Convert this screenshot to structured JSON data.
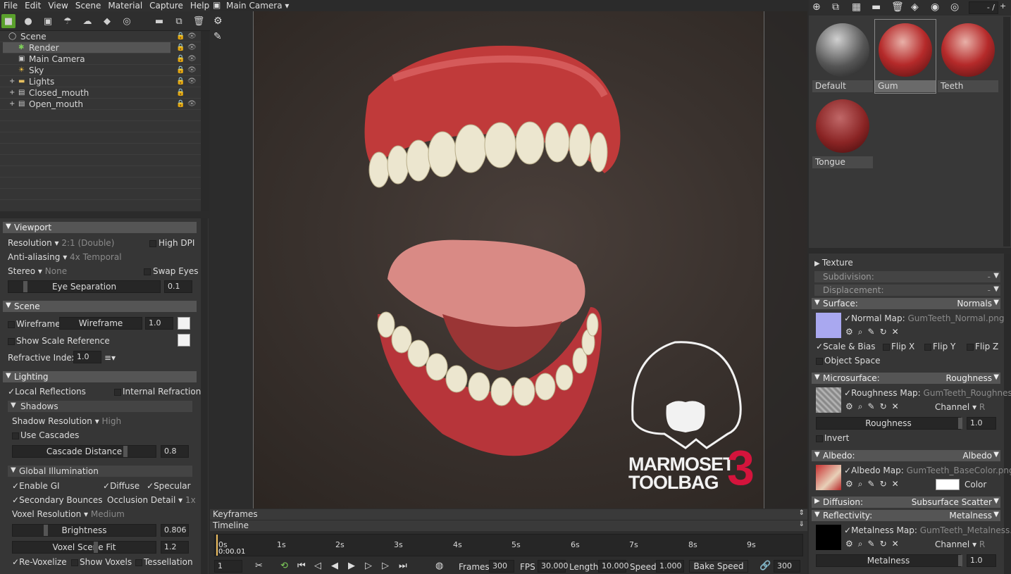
{
  "menu": [
    "File",
    "Edit",
    "View",
    "Scene",
    "Material",
    "Capture",
    "Help"
  ],
  "viewport_header": {
    "camera": "Main Camera"
  },
  "scene_tree": [
    {
      "label": "Scene",
      "icon": "scene-icon",
      "indent": 0,
      "visible": true
    },
    {
      "label": "Render",
      "icon": "render-icon",
      "indent": 1,
      "selected": true,
      "visible": true
    },
    {
      "label": "Main Camera",
      "icon": "camera-icon",
      "indent": 1,
      "visible": true
    },
    {
      "label": "Sky",
      "icon": "sky-icon",
      "indent": 1,
      "visible": true
    },
    {
      "label": "Lights",
      "icon": "folder-icon",
      "indent": 1,
      "visible": true
    },
    {
      "label": "Closed_mouth",
      "icon": "mesh-icon",
      "indent": 1,
      "visible": false
    },
    {
      "label": "Open_mouth",
      "icon": "mesh-icon",
      "indent": 1,
      "visible": true
    }
  ],
  "viewport_section": {
    "title": "Viewport",
    "resolution_label": "Resolution",
    "resolution_value": "2:1 (Double)",
    "high_dpi": "High DPI",
    "aa_label": "Anti-aliasing",
    "aa_value": "4x Temporal",
    "stereo_label": "Stereo",
    "stereo_value": "None",
    "swap_eyes": "Swap Eyes",
    "eye_sep_label": "Eye Separation",
    "eye_sep_value": "0.1"
  },
  "scene_section": {
    "title": "Scene",
    "wireframe": "Wireframe",
    "wireframe_slider": "Wireframe",
    "wireframe_value": "1.0",
    "show_scale": "Show Scale Reference",
    "refr_label": "Refractive Index:",
    "refr_value": "1.0"
  },
  "lighting_section": {
    "title": "Lighting",
    "local_refl": "Local Reflections",
    "internal_refr": "Internal Refraction",
    "shadows": "Shadows",
    "shadow_res_label": "Shadow Resolution",
    "shadow_res_value": "High",
    "use_cascades": "Use Cascades",
    "cascade_label": "Cascade Distance",
    "cascade_value": "0.8",
    "gi": "Global Illumination",
    "enable_gi": "Enable GI",
    "diffuse": "Diffuse",
    "specular": "Specular",
    "sec_bounces": "Secondary Bounces",
    "occl_label": "Occlusion Detail",
    "occl_value": "1x",
    "voxel_res_label": "Voxel Resolution",
    "voxel_res_value": "Medium",
    "brightness_label": "Brightness",
    "brightness_value": "0.806",
    "voxel_fit_label": "Voxel Scene Fit",
    "voxel_fit_value": "1.2",
    "revoxelize": "Re-Voxelize",
    "show_voxels": "Show Voxels",
    "tessellation": "Tessellation"
  },
  "logo": {
    "line1": "MARMOSET",
    "line2": "TOOLBAG",
    "version": "3"
  },
  "timeline": {
    "keyframes": "Keyframes",
    "timeline": "Timeline",
    "time": "0:00.01",
    "ticks": [
      "0s",
      "1s",
      "2s",
      "3s",
      "4s",
      "5s",
      "6s",
      "7s",
      "8s",
      "9s"
    ],
    "frame": "1",
    "frames_label": "Frames",
    "frames": "300",
    "fps_label": "FPS",
    "fps": "30.000",
    "length_label": "Length",
    "length": "10.000",
    "speed_label": "Speed",
    "speed": "1.000",
    "bake_speed": "Bake Speed",
    "bake_value": "300"
  },
  "materials": {
    "page": "- /",
    "items": [
      {
        "name": "Default",
        "selected": false
      },
      {
        "name": "Gum",
        "selected": true
      },
      {
        "name": "Teeth",
        "selected": false
      },
      {
        "name": "Tongue",
        "selected": false
      }
    ]
  },
  "material_editor": {
    "texture": "Texture",
    "subdivision": "Subdivision:",
    "sub_value": "-",
    "displacement": "Displacement:",
    "disp_value": "-",
    "surface": "Surface:",
    "surface_value": "Normals",
    "normal_map_label": "Normal Map:",
    "normal_map_file": "GumTeeth_Normal.png",
    "scale_bias": "Scale & Bias",
    "flip_x": "Flip X",
    "flip_y": "Flip Y",
    "flip_z": "Flip Z",
    "object_space": "Object Space",
    "micro": "Microsurface:",
    "micro_value": "Roughness",
    "rough_map_label": "Roughness Map:",
    "rough_map_file": "GumTeeth_Roughness.",
    "channel_label": "Channel",
    "channel_r": "R",
    "roughness_label": "Roughness",
    "roughness_value": "1.0",
    "invert": "Invert",
    "albedo": "Albedo:",
    "albedo_value": "Albedo",
    "albedo_map_label": "Albedo Map:",
    "albedo_map_file": "GumTeeth_BaseColor.png",
    "color_label": "Color",
    "diffusion": "Diffusion:",
    "diffusion_value": "Subsurface Scatter",
    "reflectivity": "Reflectivity:",
    "reflectivity_value": "Metalness",
    "metal_map_label": "Metalness Map:",
    "metal_map_file": "GumTeeth_Metalness.pr",
    "metal_channel_label": "Channel",
    "metal_channel_r": "R",
    "metalness_label": "Metalness",
    "metalness_value": "1.0"
  }
}
